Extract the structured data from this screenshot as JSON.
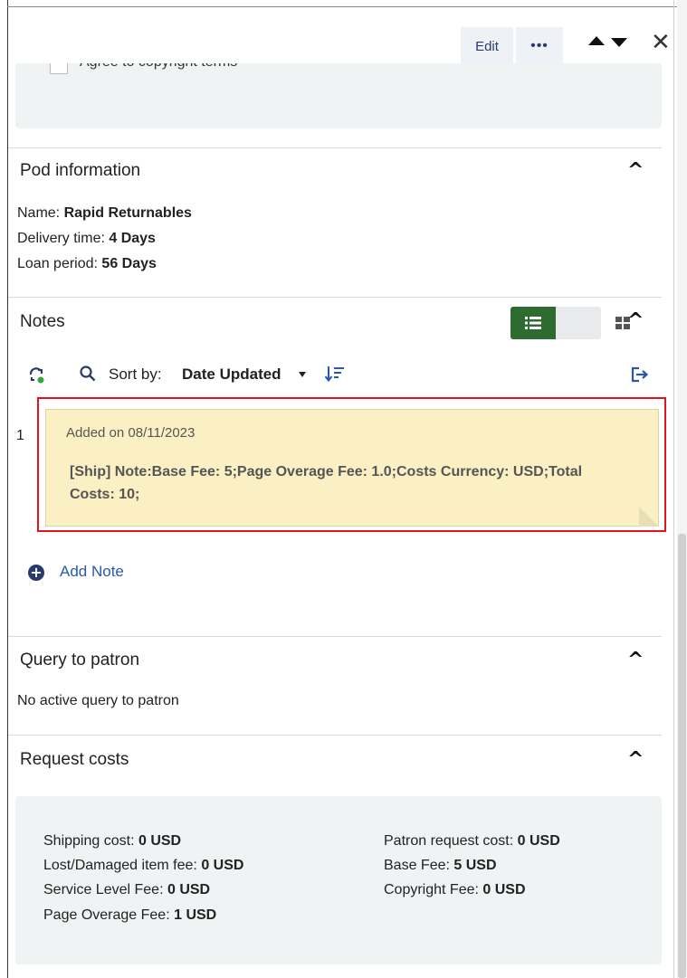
{
  "toolbar": {
    "edit_label": "Edit",
    "more_label": "•••",
    "close_label": "✕"
  },
  "copyright": {
    "checkbox_label": "Agree to copyright terms",
    "checked": false
  },
  "pod_information": {
    "title": "Pod information",
    "name_label": "Name:",
    "name_value": "Rapid Returnables",
    "delivery_label": "Delivery time:",
    "delivery_value": "4 Days",
    "loan_label": "Loan period:",
    "loan_value": "56 Days"
  },
  "notes": {
    "title": "Notes",
    "sort_by_label": "Sort by:",
    "sort_by_value": "Date Updated",
    "items": [
      {
        "index": "1",
        "date": "Added on 08/11/2023",
        "text": "[Ship] Note:Base Fee: 5;Page Overage Fee: 1.0;Costs Currency: USD;Total Costs: 10;"
      }
    ],
    "add_note_label": "Add Note",
    "accent_color": "#2e6b30"
  },
  "query_to_patron": {
    "title": "Query to patron",
    "text": "No active query to patron"
  },
  "request_costs": {
    "title": "Request costs",
    "left": [
      {
        "label": "Shipping cost:",
        "value": "0 USD"
      },
      {
        "label": "Lost/Damaged item fee:",
        "value": "0 USD"
      },
      {
        "label": "Service Level Fee:",
        "value": "0 USD"
      },
      {
        "label": "Page Overage Fee:",
        "value": "1 USD"
      }
    ],
    "right": [
      {
        "label": "Patron request cost:",
        "value": "0 USD"
      },
      {
        "label": "Base Fee:",
        "value": "5 USD"
      },
      {
        "label": "Copyright Fee:",
        "value": "0 USD"
      }
    ]
  }
}
